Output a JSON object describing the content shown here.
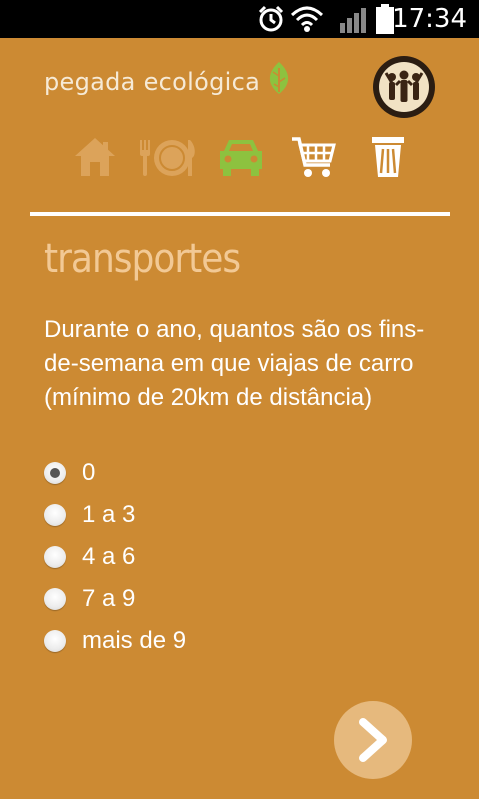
{
  "status_bar": {
    "time": "17:34",
    "icons": [
      "alarm-icon",
      "wifi-icon",
      "signal-icon",
      "battery-icon"
    ]
  },
  "header": {
    "brand": "pegada ecológica",
    "avatar_icon": "community-people-icon"
  },
  "categories": [
    {
      "name": "home",
      "icon": "house-icon",
      "state": "faded"
    },
    {
      "name": "food",
      "icon": "plate-cutlery-icon",
      "state": "faded"
    },
    {
      "name": "transport",
      "icon": "car-icon",
      "state": "active"
    },
    {
      "name": "shopping",
      "icon": "cart-icon",
      "state": "normal"
    },
    {
      "name": "waste",
      "icon": "trash-icon",
      "state": "normal"
    }
  ],
  "section": {
    "title": "transportes"
  },
  "question": {
    "text": "Durante o ano, quantos são os fins-de-semana em que viajas de carro (mínimo de 20km de distância)",
    "options": [
      {
        "label": "0",
        "checked": true
      },
      {
        "label": "1 a 3",
        "checked": false
      },
      {
        "label": "4 a 6",
        "checked": false
      },
      {
        "label": "7 a 9",
        "checked": false
      },
      {
        "label": "mais de 9",
        "checked": false
      }
    ]
  },
  "next_button": {
    "icon": "chevron-right-icon"
  },
  "colors": {
    "background": "#cc8a33",
    "accent_green": "#8dc23f",
    "title": "#f2c995",
    "faded_icon": "#dca35a",
    "next_button": "#e6b97d"
  }
}
